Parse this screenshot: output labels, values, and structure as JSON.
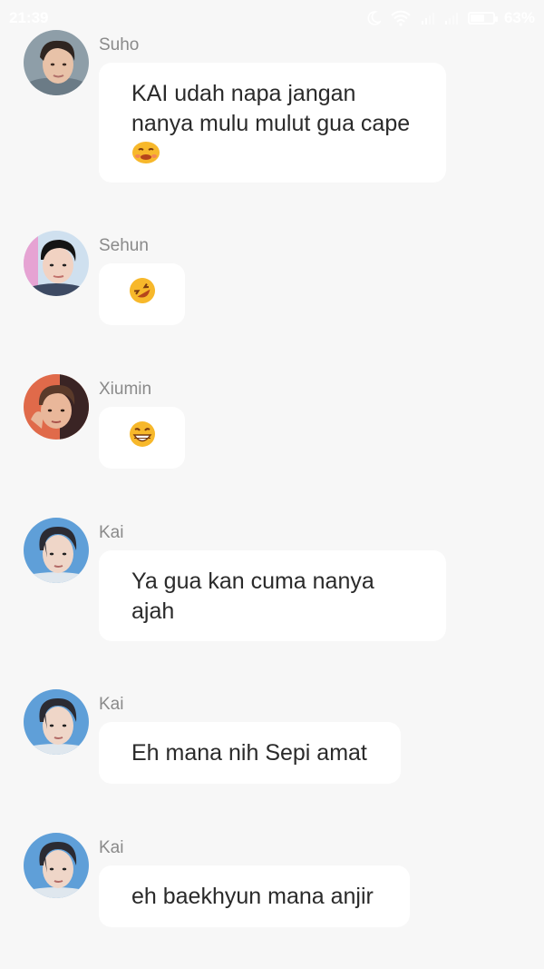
{
  "status_bar": {
    "time": "21:39",
    "battery_percent": "63%",
    "battery_level": 0.63,
    "icons": [
      "moon-icon",
      "wifi-icon",
      "signal-icon",
      "signal-icon",
      "battery-icon"
    ]
  },
  "messages": [
    {
      "sender": "Suho",
      "text": "KAI udah napa jangan nanya mulu mulut gua cape",
      "emoji": "crying-face-emoji",
      "avatar": "suho-avatar"
    },
    {
      "sender": "Sehun",
      "text": "",
      "emoji": "rolling-on-floor-laughing-emoji",
      "avatar": "sehun-avatar"
    },
    {
      "sender": "Xiumin",
      "text": "",
      "emoji": "grinning-squinting-face-emoji",
      "avatar": "xiumin-avatar"
    },
    {
      "sender": "Kai",
      "text": "Ya gua kan cuma nanya ajah",
      "emoji": "",
      "avatar": "kai-avatar"
    },
    {
      "sender": "Kai",
      "text": "Eh mana nih Sepi amat",
      "emoji": "",
      "avatar": "kai-avatar"
    },
    {
      "sender": "Kai",
      "text": "eh baekhyun mana anjir",
      "emoji": "",
      "avatar": "kai-avatar"
    }
  ],
  "colors": {
    "background": "#f7f7f7",
    "bubble": "#ffffff",
    "sender_name": "#8a8a8a",
    "message_text": "#2a2a2a",
    "emoji_yellow": "#f7b82b"
  }
}
